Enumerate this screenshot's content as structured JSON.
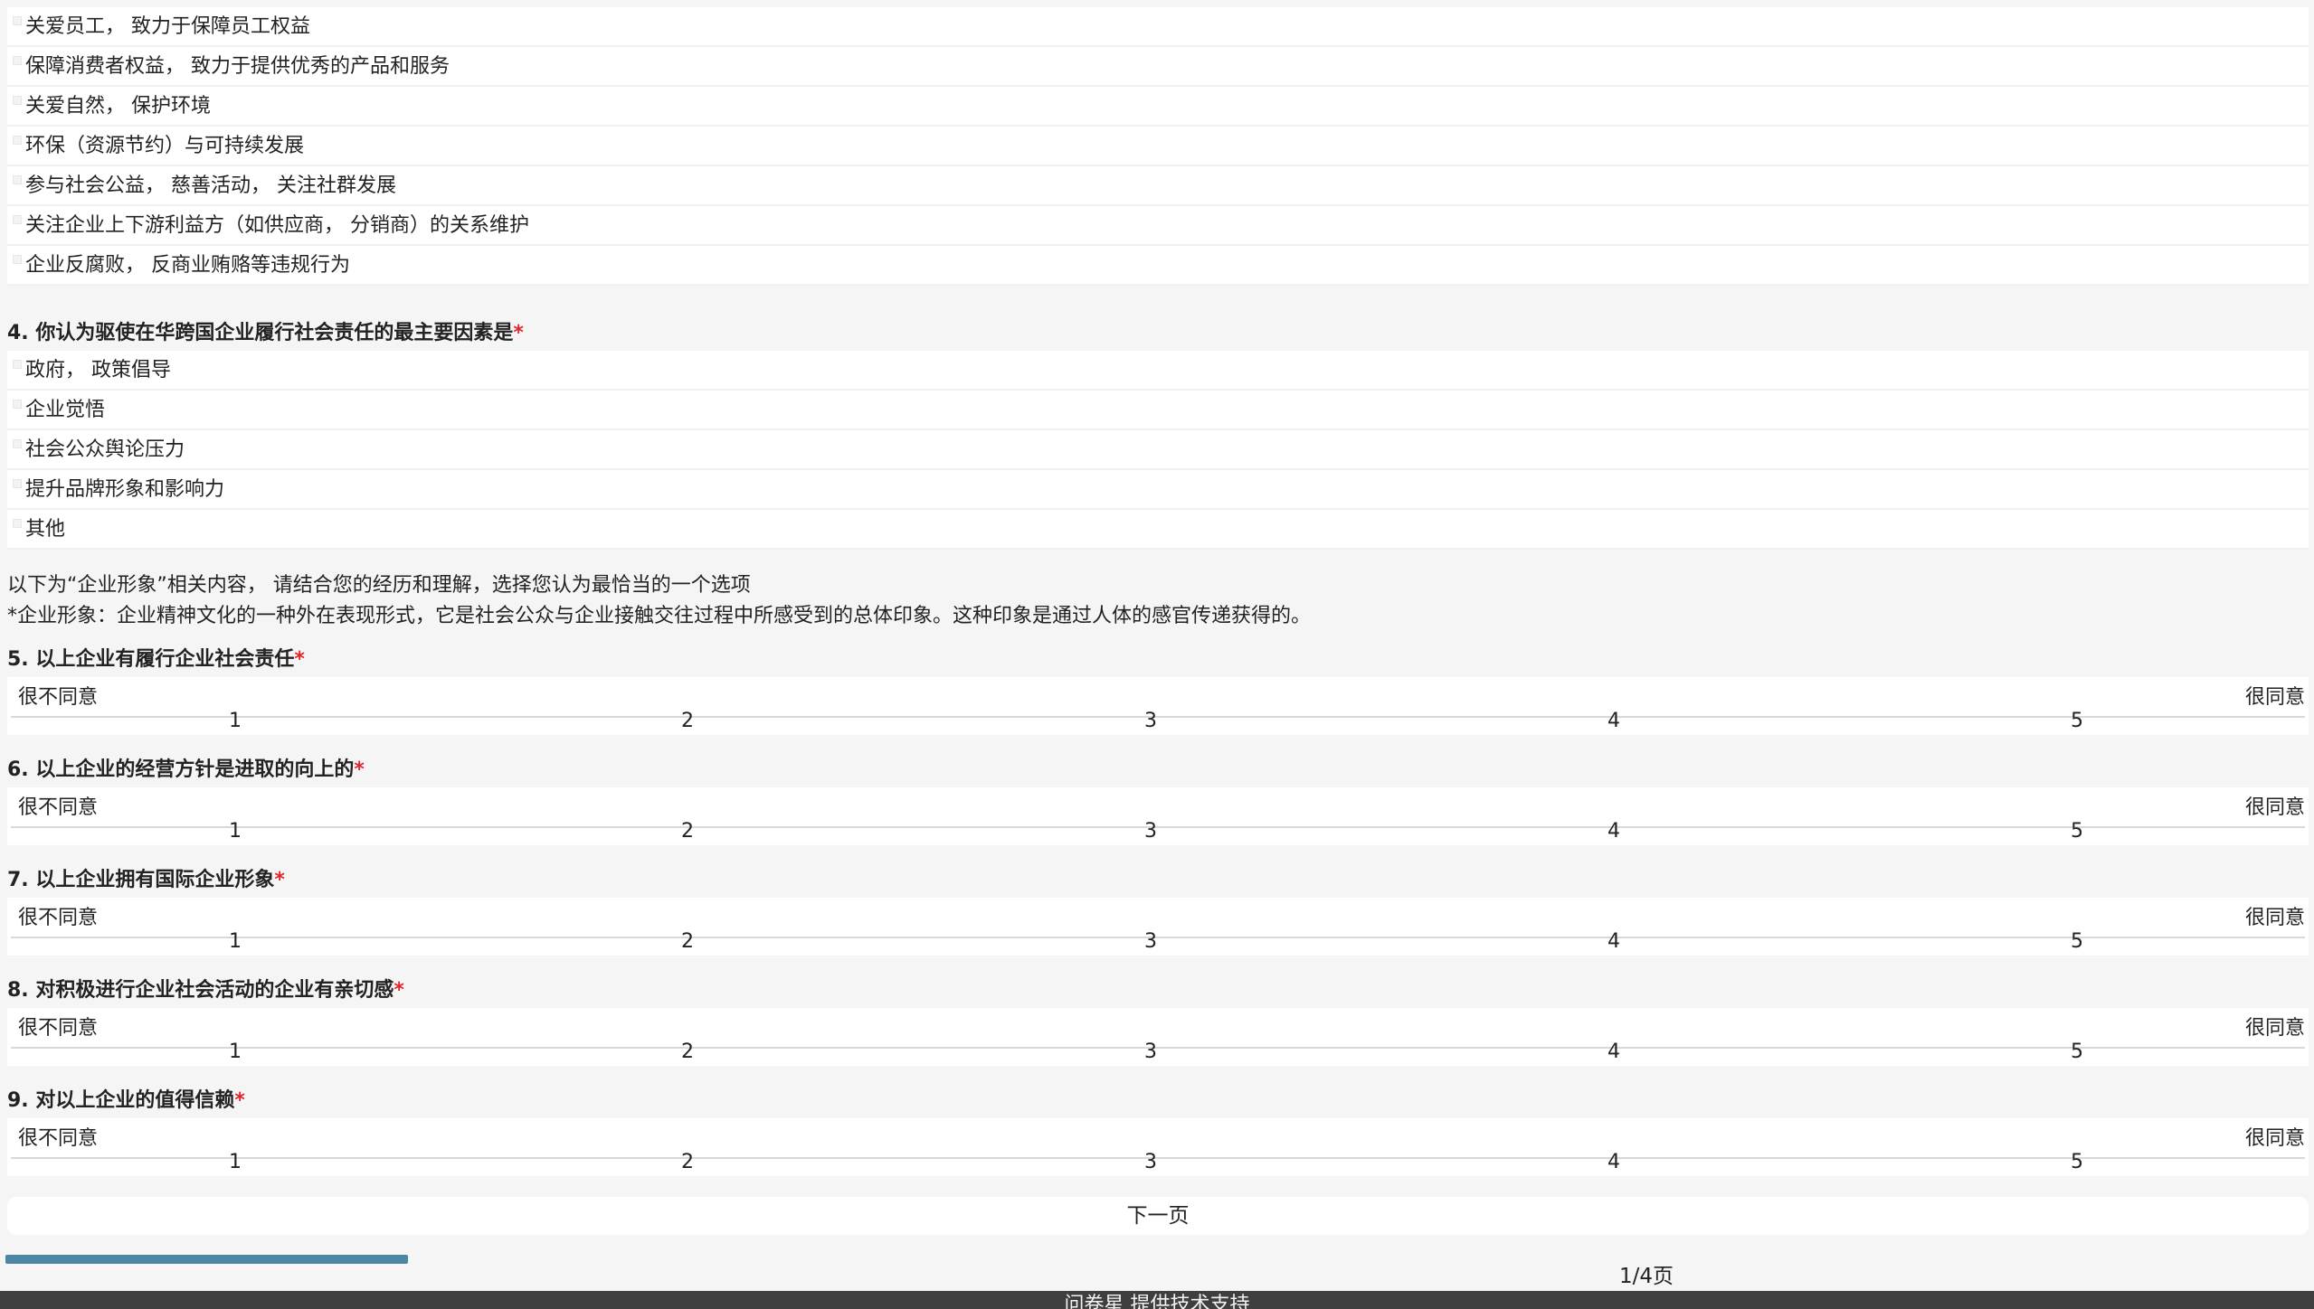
{
  "q3_options": [
    "关爱员工， 致力于保障员工权益",
    "保障消费者权益， 致力于提供优秀的产品和服务",
    "关爱自然， 保护环境",
    "环保（资源节约）与可持续发展",
    "参与社会公益， 慈善活动， 关注社群发展",
    "关注企业上下游利益方（如供应商， 分销商）的关系维护",
    "企业反腐败， 反商业贿赂等违规行为"
  ],
  "q4": {
    "title": "4. 你认为驱使在华跨国企业履行社会责任的最主要因素是",
    "required_mark": "*",
    "options": [
      "政府， 政策倡导",
      "企业觉悟",
      "社会公众舆论压力",
      "提升品牌形象和影响力",
      "其他"
    ]
  },
  "intro": {
    "line1": "以下为“企业形象”相关内容， 请结合您的经历和理解，选择您认为最恰当的一个选项",
    "line2": "*企业形象：企业精神文化的一种外在表现形式，它是社会公众与企业接触交往过程中所感受到的总体印象。这种印象是通过人体的感官传递获得的。"
  },
  "scale_labels": {
    "low": "很不同意",
    "high": "很同意",
    "points": [
      "1",
      "2",
      "3",
      "4",
      "5"
    ]
  },
  "scale_questions": [
    "5. 以上企业有履行企业社会责任",
    "6. 以上企业的经营方针是进取的向上的",
    "7. 以上企业拥有国际企业形象",
    "8. 对积极进行企业社会活动的企业有亲切感",
    "9. 对以上企业的值得信赖"
  ],
  "required_mark": "*",
  "nav": {
    "next_label": "下一页",
    "page_indicator": "1/4页",
    "progress": 0.25
  },
  "footer": {
    "text": "问卷星 提供技术支持"
  },
  "colors": {
    "accent": "#4c86a3",
    "required": "#e1252b",
    "footer_bg": "#3f3f3f"
  }
}
